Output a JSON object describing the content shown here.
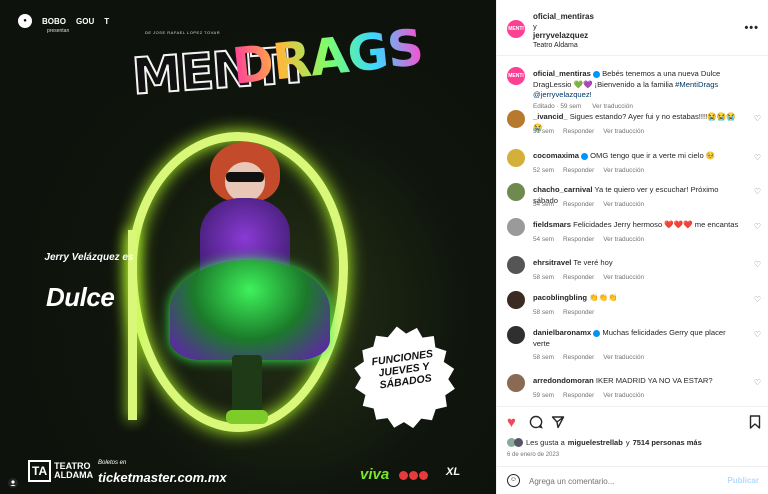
{
  "poster": {
    "sponsors": [
      "BOBO",
      "GOU",
      "T"
    ],
    "presentan": "presentan",
    "logo_small": "DE JOSE RAFAEL LOPEZ TOVAR",
    "logo_menti": "MENTI",
    "logo_drags": "DRAGS",
    "jerry_line": "Jerry Velázquez es",
    "dulce": "Dulce",
    "badge": "FUNCIONES JUEVES Y SÁBADOS",
    "ta": "TA",
    "teatro": "TEATRO ALDAMA",
    "boletos": "Boletos en",
    "ticket": "ticketmaster.com.mx",
    "viva": "viva",
    "xl": "XL"
  },
  "header": {
    "user1": "oficial_mentiras",
    "y": "y",
    "user2": "jerryvelazquez",
    "location": "Teatro Aldama",
    "more_icon": "more-horizontal-icon"
  },
  "caption": {
    "user": "oficial_mentiras",
    "text": " Bebés tenemos a una nueva Dulce DragLessio 💚💜 ¡Bienvenido a la familia ",
    "hashtag": "#MentiDrags",
    "mention": "@jerryvelazquez!",
    "edited": "Editado · 59 sem",
    "translate": "Ver traducción"
  },
  "comments": [
    {
      "user": "_ivancid_",
      "text": "Sigues estando? Ayer fui y no estabas!!!!😭😭😭😭",
      "time": "51 sem",
      "reply": "Responder",
      "translate": "Ver traducción",
      "color": "#b7792e"
    },
    {
      "user": "cocomaxima",
      "text": "OMG tengo que ir a verte mi cielo 🥺",
      "time": "52 sem",
      "reply": "Responder",
      "translate": "Ver traducción",
      "color": "#d4b03a"
    },
    {
      "user": "chacho_carnival",
      "text": "Ya te quiero ver y escuchar! Próximo sábado",
      "time": "54 sem",
      "reply": "Responder",
      "translate": "Ver traducción",
      "color": "#6f8a4e"
    },
    {
      "user": "fieldsmars",
      "text": "Felicidades Jerry hermoso ❤️❤️❤️ me encantas",
      "time": "54 sem",
      "reply": "Responder",
      "translate": "Ver traducción",
      "color": "#9a9a9a"
    },
    {
      "user": "ehrsitravel",
      "text": "Te veré hoy",
      "time": "58 sem",
      "reply": "Responder",
      "translate": "Ver traducción",
      "color": "#555555"
    },
    {
      "user": "pacoblingbling",
      "text": "👏👏👏",
      "time": "58 sem",
      "reply": "Responder",
      "translate": "",
      "color": "#3a2a22"
    },
    {
      "user": "danielbaronamx",
      "text": "Muchas felicidades Gerry que placer verte",
      "time": "58 sem",
      "reply": "Responder",
      "translate": "Ver traducción",
      "color": "#2f2f2f"
    },
    {
      "user": "arredondomoran",
      "text": "IKER MADRID YA NO VA ESTAR?",
      "time": "59 sem",
      "reply": "Responder",
      "translate": "Ver traducción",
      "color": "#8a6a52"
    }
  ],
  "likes": {
    "text_pre": "Les gusta a ",
    "user": "miguelestrellab",
    "text_mid": " y ",
    "count": "7514 personas más"
  },
  "date": "6 de enero de 2023",
  "add_comment": {
    "placeholder": "Agrega un comentario...",
    "publish": "Publicar"
  }
}
